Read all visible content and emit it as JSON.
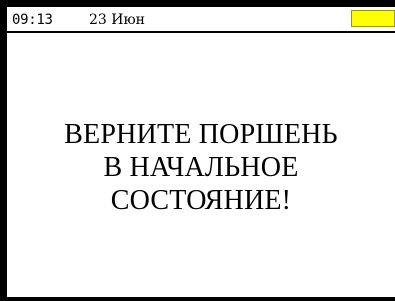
{
  "status_bar": {
    "time": "09:13",
    "date": "23 Июн",
    "battery_color": "#ffff00"
  },
  "message": {
    "lines": [
      "ВЕРНИТЕ ПОРШЕНЬ",
      "В НАЧАЛЬНОЕ",
      "СОСТОЯНИЕ!"
    ]
  }
}
